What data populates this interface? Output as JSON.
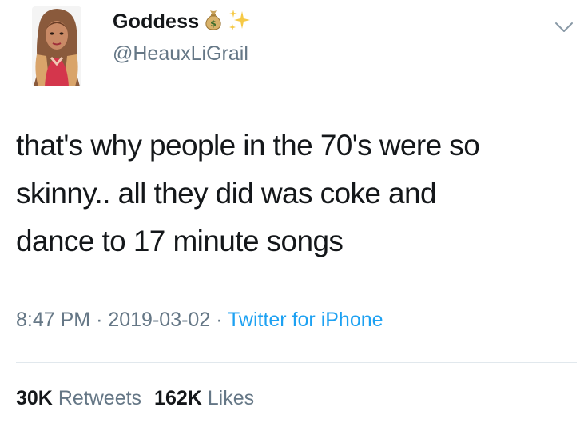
{
  "author": {
    "display_name": "Goddess",
    "handle": "@HeauxLiGrail",
    "name_emojis": [
      "money-bag-icon",
      "sparkles-icon"
    ]
  },
  "tweet": {
    "text_lines": [
      "that's why people in the 70's were so",
      "skinny.. all they did was coke and",
      "dance to 17 minute songs"
    ],
    "time": "8:47 PM",
    "date": "2019-03-02",
    "separator": "·",
    "source": "Twitter for iPhone"
  },
  "stats": {
    "retweets_count": "30K",
    "retweets_label": "Retweets",
    "likes_count": "162K",
    "likes_label": "Likes"
  },
  "colors": {
    "text": "#14171a",
    "secondary": "#657786",
    "link": "#1da1f2",
    "divider": "#e1e8ed"
  }
}
